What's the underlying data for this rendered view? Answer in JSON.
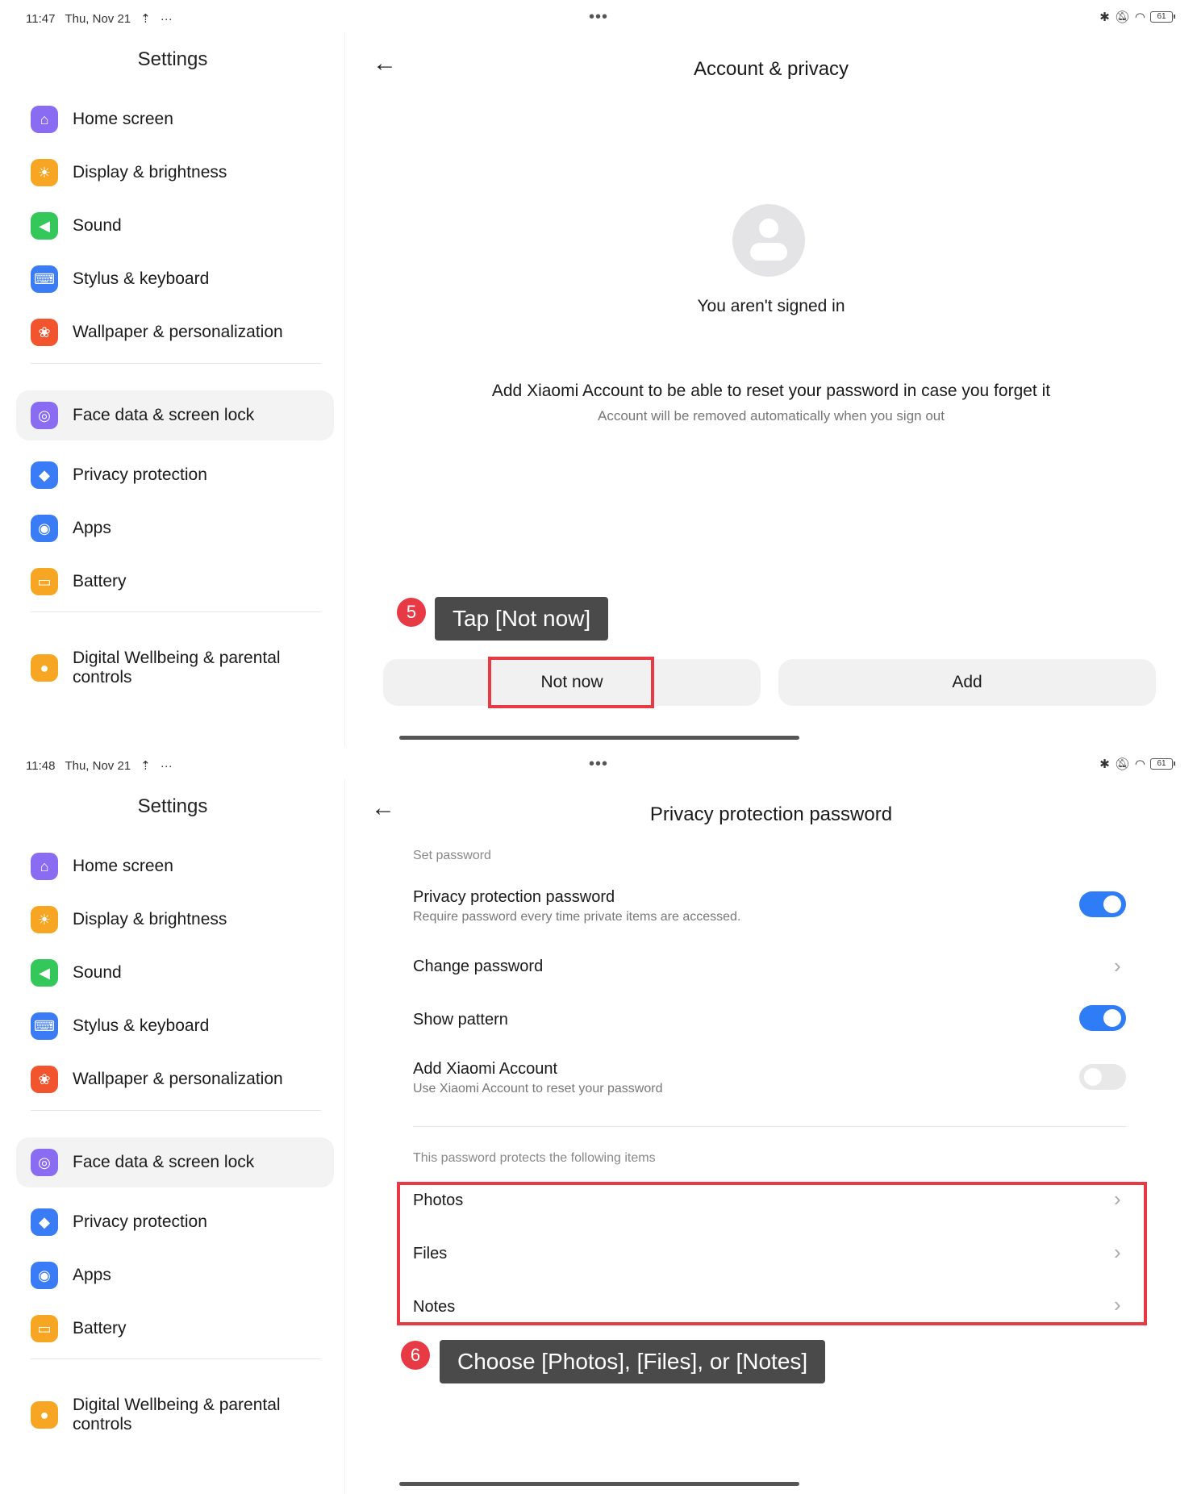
{
  "colors": {
    "accent_blue": "#2f7df6",
    "annotation_red": "#e83a45",
    "callout_bg": "#4a4a4a",
    "selected_bg": "#f3f3f3"
  },
  "sidebar_items": [
    {
      "key": "home",
      "label": "Home screen",
      "icon": "home-icon",
      "color": "#8a6cf3"
    },
    {
      "key": "display",
      "label": "Display & brightness",
      "icon": "sun-icon",
      "color": "#f6a623"
    },
    {
      "key": "sound",
      "label": "Sound",
      "icon": "speaker-icon",
      "color": "#34c759"
    },
    {
      "key": "stylus",
      "label": "Stylus & keyboard",
      "icon": "keyboard-icon",
      "color": "#3a7bf6"
    },
    {
      "key": "wallpaper",
      "label": "Wallpaper & personalization",
      "icon": "flower-icon",
      "color": "#f2542d"
    },
    {
      "key": "face",
      "label": "Face data & screen lock",
      "icon": "face-lock-icon",
      "color": "#8a6cf3"
    },
    {
      "key": "privacy",
      "label": "Privacy protection",
      "icon": "shield-icon",
      "color": "#3a7bf6"
    },
    {
      "key": "apps",
      "label": "Apps",
      "icon": "apps-icon",
      "color": "#3a7bf6"
    },
    {
      "key": "battery",
      "label": "Battery",
      "icon": "battery-icon",
      "color": "#f6a623"
    },
    {
      "key": "wellbeing",
      "label": "Digital Wellbeing & parental controls",
      "icon": "person-icon",
      "color": "#f6a623"
    }
  ],
  "top": {
    "status": {
      "time": "11:47",
      "date": "Thu, Nov 21",
      "battery": "61"
    },
    "sidebar_title": "Settings",
    "page_title": "Account & privacy",
    "signed_out_text": "You aren't signed in",
    "info_text": "Add Xiaomi Account to be able to reset your password in case you forget it",
    "info_subtext": "Account will be removed automatically when you sign out",
    "not_now_label": "Not now",
    "add_label": "Add",
    "step_number": "5",
    "callout": "Tap [Not now]"
  },
  "bottom": {
    "status": {
      "time": "11:48",
      "date": "Thu, Nov 21",
      "battery": "61"
    },
    "sidebar_title": "Settings",
    "page_title": "Privacy protection password",
    "set_password_header": "Set password",
    "ppp_title": "Privacy protection password",
    "ppp_subtitle": "Require password every time private items are accessed.",
    "ppp_toggle": true,
    "change_password": "Change password",
    "show_pattern": "Show pattern",
    "show_pattern_toggle": true,
    "add_account_title": "Add Xiaomi Account",
    "add_account_subtitle": "Use Xiaomi Account to reset your password",
    "add_account_toggle": false,
    "protects_header": "This password protects the following items",
    "items": [
      "Photos",
      "Files",
      "Notes"
    ],
    "step_number": "6",
    "callout": "Choose [Photos], [Files], or [Notes]"
  }
}
